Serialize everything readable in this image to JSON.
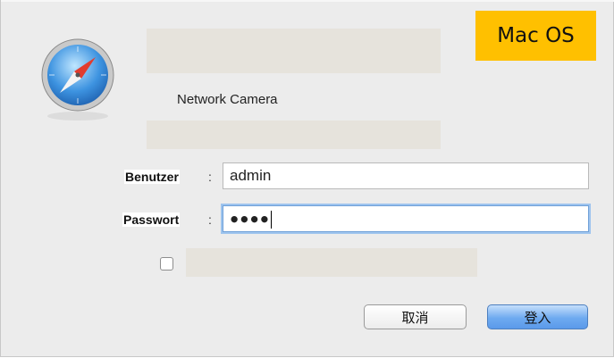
{
  "badge": {
    "label": "Mac OS"
  },
  "dialog": {
    "title": "Network Camera",
    "username": {
      "label": "Benutzer",
      "colon": ":",
      "value": "admin"
    },
    "password": {
      "label": "Passwort",
      "colon": ":",
      "value": "●●●●"
    },
    "buttons": {
      "cancel": "取消",
      "login": "登入"
    }
  },
  "colors": {
    "badge": "#ffc000",
    "focus": "#9ec4ee",
    "primary_button": "#6eaaf0"
  }
}
